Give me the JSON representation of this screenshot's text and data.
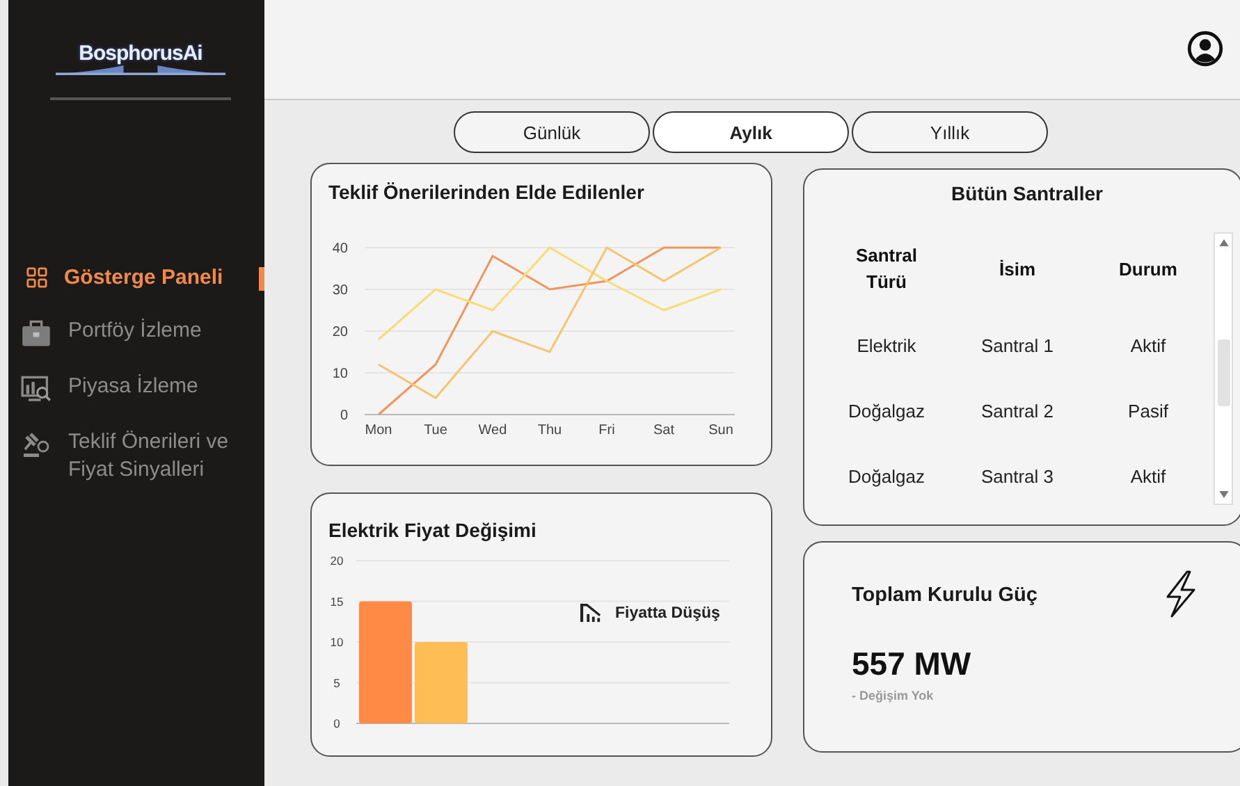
{
  "sidebar": {
    "logo": "BosphorusAi",
    "items": [
      {
        "label": "Gösterge Paneli",
        "kind": "grid",
        "selected": true
      },
      {
        "label": "Portföy İzleme",
        "kind": "briefcase",
        "selected": false
      },
      {
        "label": "Piyasa İzleme",
        "kind": "monitor",
        "selected": false
      },
      {
        "label": "Teklif Önerileri ve Fiyat Sinyalleri",
        "kind": "gavel",
        "selected": false
      }
    ]
  },
  "period_tabs": [
    {
      "label": "Günlük",
      "selected": false
    },
    {
      "label": "Aylık",
      "selected": true
    },
    {
      "label": "Yıllık",
      "selected": false
    }
  ],
  "offers_card": {
    "title": "Teklif Önerilerinden Elde Edilenler",
    "chart_data": {
      "type": "line",
      "categories": [
        "Mon",
        "Tue",
        "Wed",
        "Thu",
        "Fri",
        "Sat",
        "Sun"
      ],
      "ylim": [
        0,
        40
      ],
      "yticks": [
        0,
        10,
        20,
        30,
        40
      ],
      "grid": true,
      "series": [
        {
          "color": "#f0955c",
          "values": [
            0,
            12,
            38,
            30,
            32,
            40,
            40
          ]
        },
        {
          "color": "#f8dc78",
          "values": [
            18,
            30,
            25,
            40,
            32,
            25,
            30
          ]
        },
        {
          "color": "#f4c46e",
          "values": [
            12,
            4,
            20,
            15,
            40,
            32,
            40
          ]
        }
      ]
    }
  },
  "price_card": {
    "title": "Elektrik Fiyat Değişimi",
    "legend": "Fiyatta Düşüş",
    "chart_data": {
      "type": "bar",
      "ylim": [
        0,
        20
      ],
      "yticks": [
        0,
        5,
        10,
        15,
        20
      ],
      "grid": true,
      "series": [
        {
          "color": "#ff8a45",
          "values": [
            15
          ]
        },
        {
          "color": "#ffbd55",
          "values": [
            10
          ]
        }
      ]
    }
  },
  "plants_card": {
    "title": "Bütün Santraller",
    "columns": [
      "Santral Türü",
      "İsim",
      "Durum"
    ],
    "rows": [
      [
        "Elektrik",
        "Santral 1",
        "Aktif"
      ],
      [
        "Doğalgaz",
        "Santral 2",
        "Pasif"
      ],
      [
        "Doğalgaz",
        "Santral 3",
        "Aktif"
      ]
    ]
  },
  "power_card": {
    "title": "Toplam Kurulu Güç",
    "value": "557 MW",
    "change": "- Değişim Yok"
  }
}
